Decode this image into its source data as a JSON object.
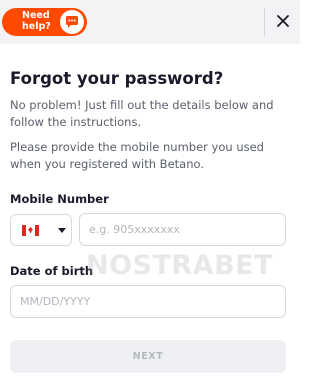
{
  "header": {
    "help_label": "Need help?",
    "chat_icon": "chat-bubble-icon",
    "close_icon": "close-icon"
  },
  "form": {
    "title": "Forgot your password?",
    "intro": "No problem! Just fill out the details below and follow the instructions.",
    "instruction": "Please provide the mobile number you used when you registered with Betano.",
    "mobile_label": "Mobile Number",
    "country_flag": "canada-flag-icon",
    "phone_placeholder": "e.g. 905xxxxxxx",
    "phone_value": "",
    "dob_label": "Date of birth",
    "dob_placeholder": "MM/DD/YYYY",
    "dob_value": "",
    "next_label": "NEXT"
  },
  "watermark": "NOSTRABET",
  "colors": {
    "accent": "#ff4a00",
    "disabled_button_bg": "#eef0f3",
    "disabled_button_text": "#b5b8bf"
  }
}
